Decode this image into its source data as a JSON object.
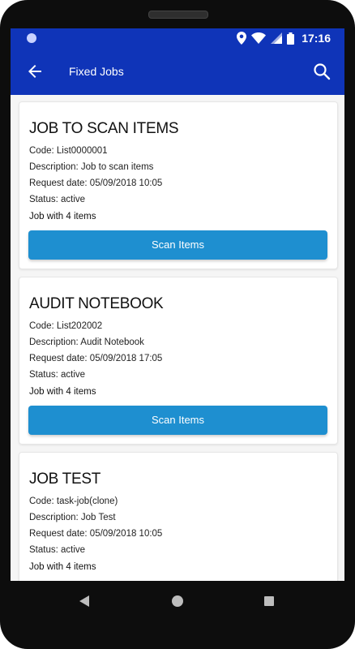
{
  "status_bar": {
    "time": "17:16"
  },
  "app_bar": {
    "title": "Fixed Jobs"
  },
  "jobs": [
    {
      "title": "JOB TO SCAN ITEMS",
      "code": "Code: List0000001",
      "description": "Description: Job to scan items",
      "request_date": "Request date: 05/09/2018 10:05",
      "status": "Status: active",
      "items": "Job with 4 items",
      "button": "Scan Items"
    },
    {
      "title": "AUDIT NOTEBOOK",
      "code": "Code: List202002",
      "description": "Description: Audit Notebook",
      "request_date": "Request date: 05/09/2018 17:05",
      "status": "Status: active",
      "items": "Job with 4 items",
      "button": "Scan Items"
    },
    {
      "title": "JOB TEST",
      "code": "Code: task-job(clone)",
      "description": "Description: Job Test",
      "request_date": "Request date: 05/09/2018 10:05",
      "status": "Status: active",
      "items": "Job with 4 items"
    }
  ],
  "colors": {
    "primary": "#0f34b8",
    "button": "#1e8fd0"
  }
}
